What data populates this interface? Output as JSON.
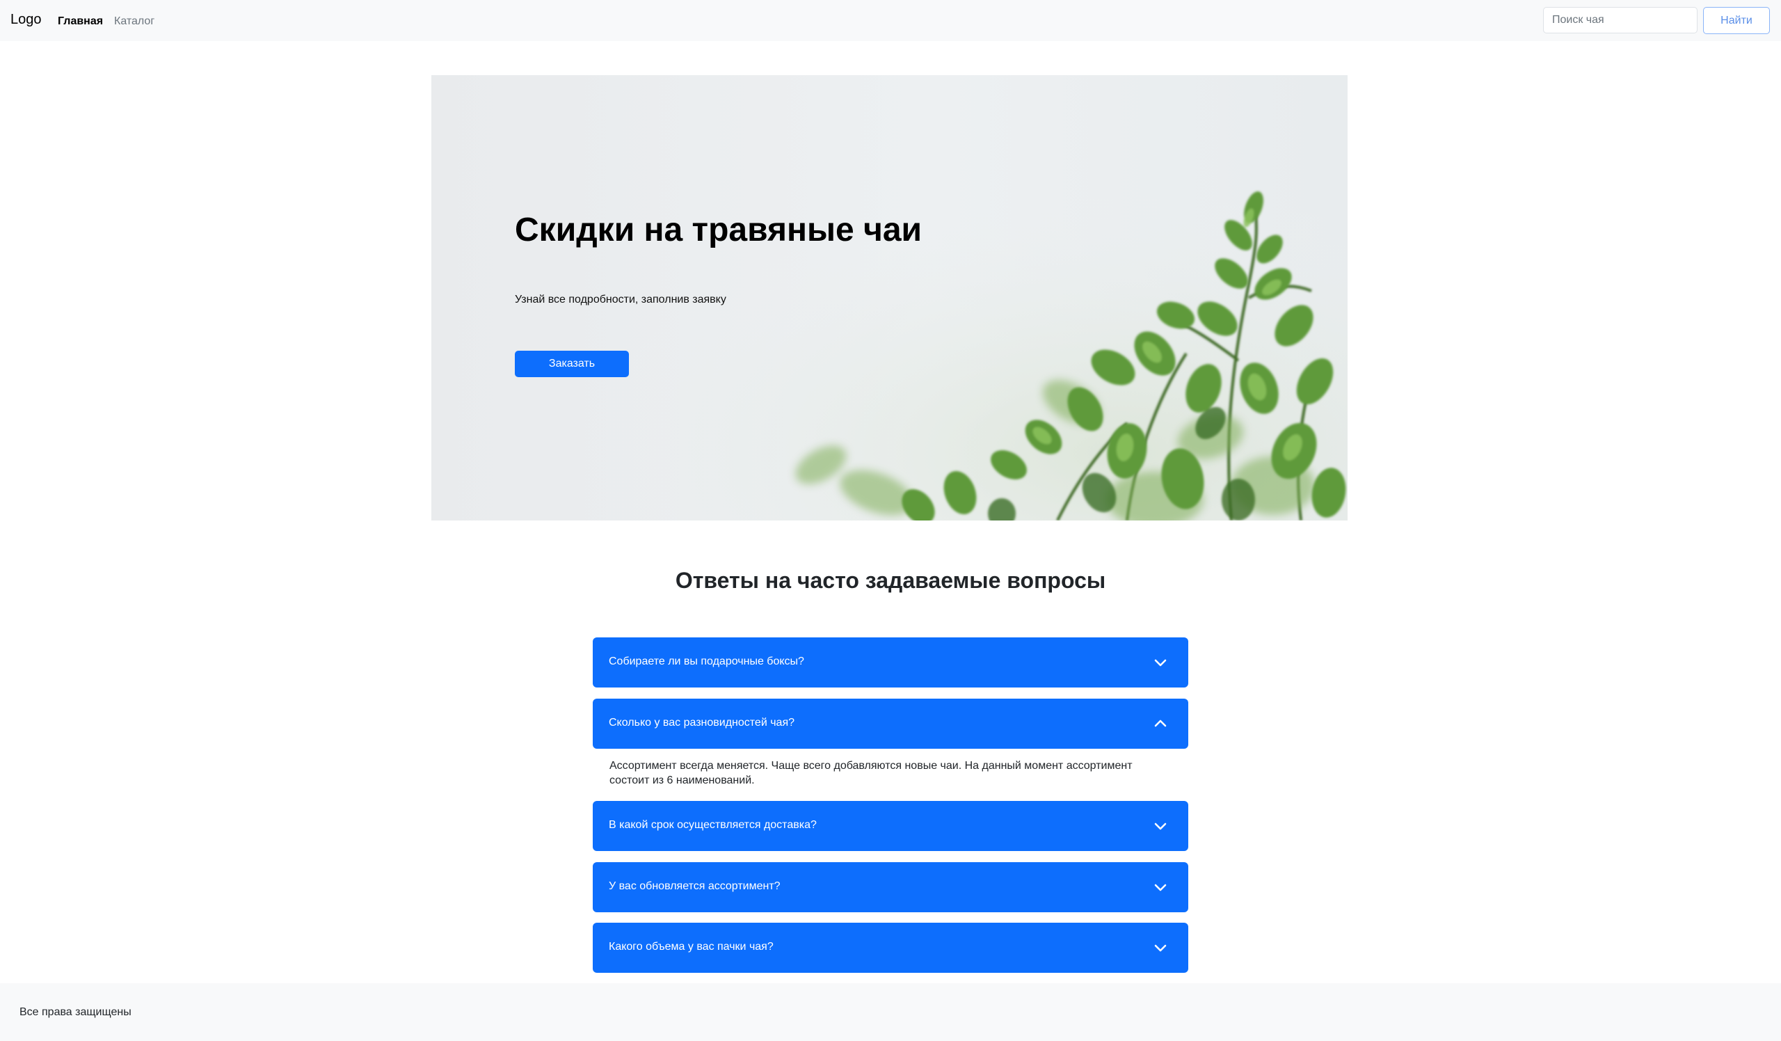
{
  "header": {
    "logo": "Logo",
    "nav": [
      {
        "label": "Главная",
        "active": true
      },
      {
        "label": "Каталог",
        "active": false
      }
    ],
    "search": {
      "placeholder": "Поиск чая",
      "value": "",
      "button_label": "Найти"
    }
  },
  "hero": {
    "title": "Скидки на травяные чаи",
    "text": "Узнай все подробности, заполнив заявку",
    "button_label": "Заказать",
    "image": "green-plant-leaves"
  },
  "faq": {
    "title": "Ответы на часто задаваемые вопросы",
    "items": [
      {
        "question": "Собираете ли вы подарочные боксы?",
        "expanded": false,
        "icon": "chevron-down-icon"
      },
      {
        "question": "Сколько у вас разновидностей чая?",
        "expanded": true,
        "icon": "chevron-up-icon",
        "answer": "Ассортимент всегда меняется. Чаще всего добавляются новые чаи. На данный момент ассортимент состоит из 6 наименований."
      },
      {
        "question": "В какой срок осуществляется доставка?",
        "expanded": false,
        "icon": "chevron-down-icon"
      },
      {
        "question": "У вас обновляется ассортимент?",
        "expanded": false,
        "icon": "chevron-down-icon"
      },
      {
        "question": "Какого объема у вас пачки чая?",
        "expanded": false,
        "icon": "chevron-down-icon"
      }
    ]
  },
  "footer": {
    "text": "Все права защищены"
  },
  "colors": {
    "accent": "#0d6efd",
    "navbar_bg": "#f8f9fa",
    "footer_bg": "#f8f9fa",
    "hero_bg": "#eceff1",
    "leaf_green": "#5e9a3a"
  }
}
